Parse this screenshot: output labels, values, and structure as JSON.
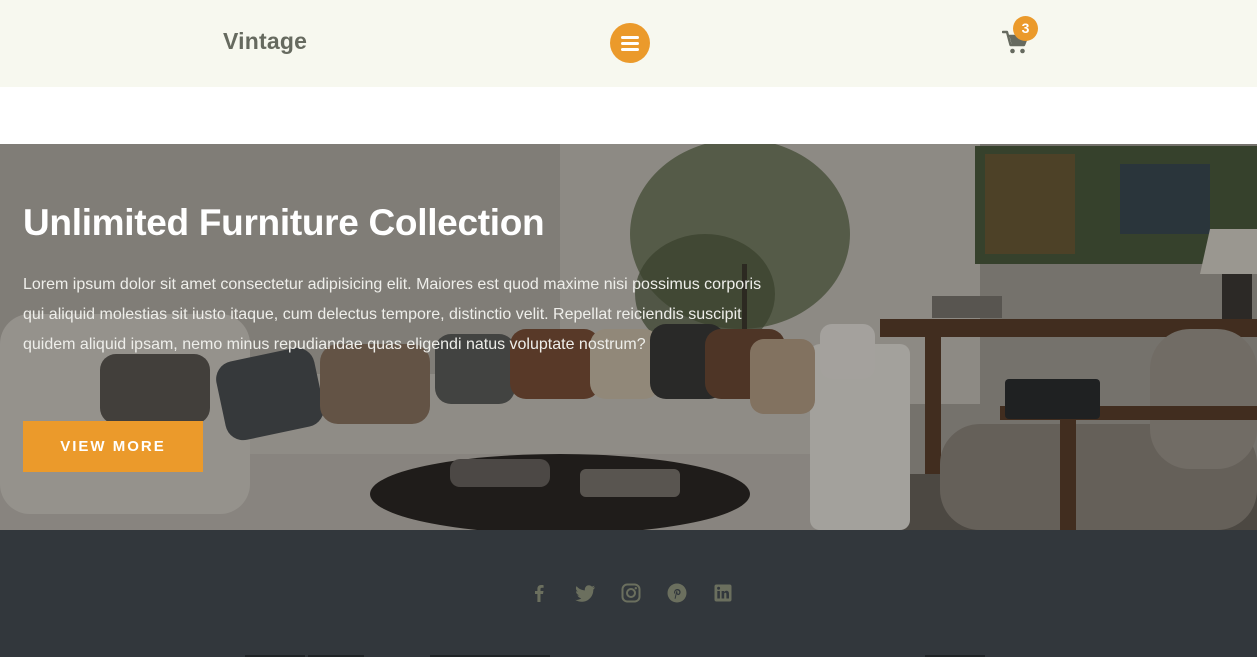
{
  "header": {
    "brand": "Vintage",
    "menu_icon": "hamburger-menu-icon",
    "cart_icon": "shopping-cart-icon",
    "cart_count": "3"
  },
  "hero": {
    "title": "Unlimited Furniture Collection",
    "text": "Lorem ipsum dolor sit amet consectetur adipisicing elit. Maiores est quod maxime nisi possimus corporis qui aliquid molestias sit iusto itaque, cum delectus tempore, distinctio velit. Repellat reiciendis suscipit quidem aliquid ipsam, nemo minus repudiandae quas eligendi natus voluptate nostrum?",
    "button_label": "VIEW MORE"
  },
  "footer": {
    "social": [
      "facebook-icon",
      "twitter-icon",
      "instagram-icon",
      "pinterest-icon",
      "linkedin-icon"
    ]
  },
  "colors": {
    "accent": "#eb9a2b",
    "header_bg": "#f7f8ef",
    "footer_bg": "#32373c",
    "icon_muted": "#6b6f5e"
  }
}
